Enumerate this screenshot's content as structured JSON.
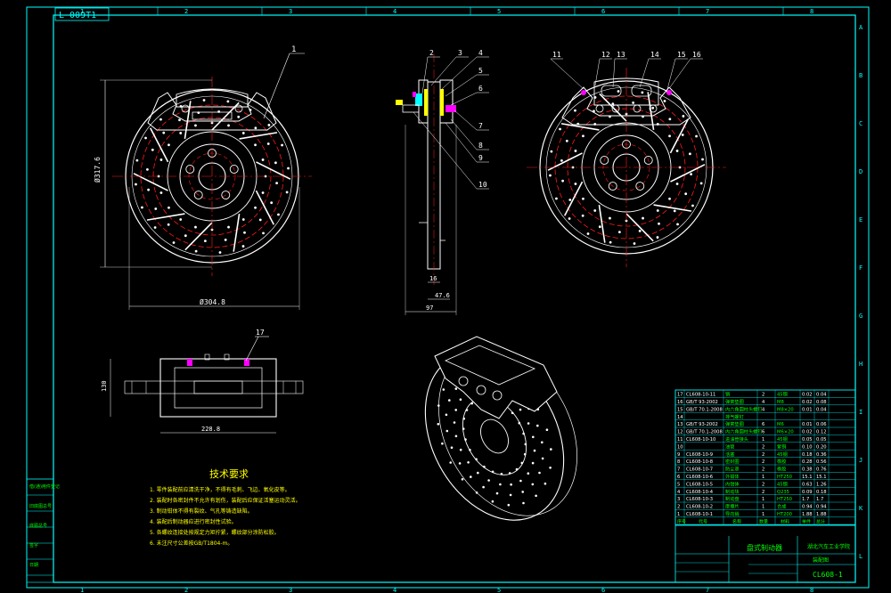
{
  "drawing": {
    "title_code": "L-009T1",
    "drawing_number": "CL608-1"
  },
  "grid": {
    "columns": [
      "1",
      "2",
      "3",
      "4",
      "5",
      "6",
      "7",
      "8"
    ],
    "rows": [
      "A",
      "B",
      "C",
      "D",
      "E",
      "F",
      "G",
      "H",
      "I",
      "J",
      "K",
      "L"
    ]
  },
  "front_view": {
    "balloon": "1",
    "dim_height": "Ø317.6",
    "dim_width": "Ø304.8"
  },
  "side_view": {
    "balloons": [
      "2",
      "3",
      "4",
      "5",
      "6",
      "7",
      "8",
      "9",
      "10"
    ],
    "dim_bottom": "97",
    "dim_mid": "47.6",
    "dim_small": "16"
  },
  "back_view": {
    "balloons": [
      "11",
      "12",
      "13",
      "14",
      "15",
      "16"
    ]
  },
  "top_view": {
    "balloon": "17",
    "dim_height": "130",
    "dim_width": "228.8"
  },
  "tech_notes": {
    "title": "技术要求",
    "notes": [
      "1. 零件装配前应清洗干净，不得有毛刺、飞边、氧化皮等。",
      "2. 装配时各密封件不允许有划伤，装配后应保证活塞运动灵活。",
      "3. 制动钳体不得有裂纹、气孔等铸造缺陷。",
      "4. 装配后制动器应进行密封性试验。",
      "5. 各螺纹连接处按规定力矩拧紧，螺纹部分涂防松胶。",
      "6. 未注尺寸公差按GB/T1804-m。"
    ]
  },
  "left_strip": [
    "借(通)用件登记",
    "旧底图总号",
    "底图总号",
    "签字",
    "日期"
  ],
  "bom": [
    {
      "no": "17",
      "code": "CL608-10-11",
      "name": "销",
      "qty": "2",
      "mat": "45钢",
      "w1": "0.02",
      "w2": "0.04"
    },
    {
      "no": "16",
      "code": "GB/T 93-2002",
      "name": "弹簧垫圈",
      "qty": "4",
      "mat": "M8",
      "w1": "0.02",
      "w2": "0.08"
    },
    {
      "no": "15",
      "code": "GB/T 70.1-2008",
      "name": "内六角圆柱头螺钉",
      "qty": "4",
      "mat": "M8×20",
      "w1": "0.01",
      "w2": "0.04"
    },
    {
      "no": "14",
      "code": "",
      "name": "排气螺钉",
      "qty": "",
      "mat": "",
      "w1": "",
      "w2": ""
    },
    {
      "no": "13",
      "code": "GB/T 93-2002",
      "name": "弹簧垫圈",
      "qty": "6",
      "mat": "M6",
      "w1": "0.01",
      "w2": "0.06"
    },
    {
      "no": "12",
      "code": "GB/T 70.1-2008",
      "name": "内六角圆柱头螺钉",
      "qty": "6",
      "mat": "M6×20",
      "w1": "0.02",
      "w2": "0.12"
    },
    {
      "no": "11",
      "code": "CL608-10-10",
      "name": "进油管接头",
      "qty": "1",
      "mat": "45钢",
      "w1": "0.05",
      "w2": "0.05"
    },
    {
      "no": "10",
      "code": "",
      "name": "油管",
      "qty": "2",
      "mat": "紫铜",
      "w1": "0.10",
      "w2": "0.20"
    },
    {
      "no": "9",
      "code": "CL608-10-9",
      "name": "活塞",
      "qty": "2",
      "mat": "45钢",
      "w1": "0.18",
      "w2": "0.36"
    },
    {
      "no": "8",
      "code": "CL608-10-8",
      "name": "密封圈",
      "qty": "2",
      "mat": "橡胶",
      "w1": "0.28",
      "w2": "0.56"
    },
    {
      "no": "7",
      "code": "CL608-10-7",
      "name": "防尘罩",
      "qty": "2",
      "mat": "橡胶",
      "w1": "0.38",
      "w2": "0.76"
    },
    {
      "no": "6",
      "code": "CL608-10-6",
      "name": "外钳体",
      "qty": "1",
      "mat": "HT250",
      "w1": "15.1",
      "w2": "15.1"
    },
    {
      "no": "5",
      "code": "CL608-10-5",
      "name": "内钳体",
      "qty": "2",
      "mat": "45钢",
      "w1": "0.63",
      "w2": "1.26"
    },
    {
      "no": "4",
      "code": "CL608-10-4",
      "name": "制动块",
      "qty": "2",
      "mat": "Q235",
      "w1": "0.09",
      "w2": "0.18"
    },
    {
      "no": "3",
      "code": "CL608-10-3",
      "name": "制动盘",
      "qty": "1",
      "mat": "HT250",
      "w1": "1.7",
      "w2": "1.7"
    },
    {
      "no": "2",
      "code": "CL608-10-2",
      "name": "摩擦片",
      "qty": "1",
      "mat": "合成",
      "w1": "0.94",
      "w2": "0.94"
    },
    {
      "no": "1",
      "code": "CL608-10-1",
      "name": "导向销",
      "qty": "1",
      "mat": "HT200",
      "w1": "1.88",
      "w2": "1.88"
    }
  ],
  "bom_header": [
    "序号",
    "代号",
    "名称",
    "数量",
    "材料",
    "单件",
    "总计"
  ],
  "title_block": {
    "assembly_name": "盘式制动器",
    "school": "湖北汽车工业学院",
    "sheet_label": "装配图"
  },
  "colors": {
    "frame": "#00ffff",
    "red": "#ff1a1a",
    "green": "#00ff00",
    "yellow": "#ffff00",
    "magenta": "#ff00ff",
    "blue": "#2060ff",
    "white": "#ffffff"
  }
}
